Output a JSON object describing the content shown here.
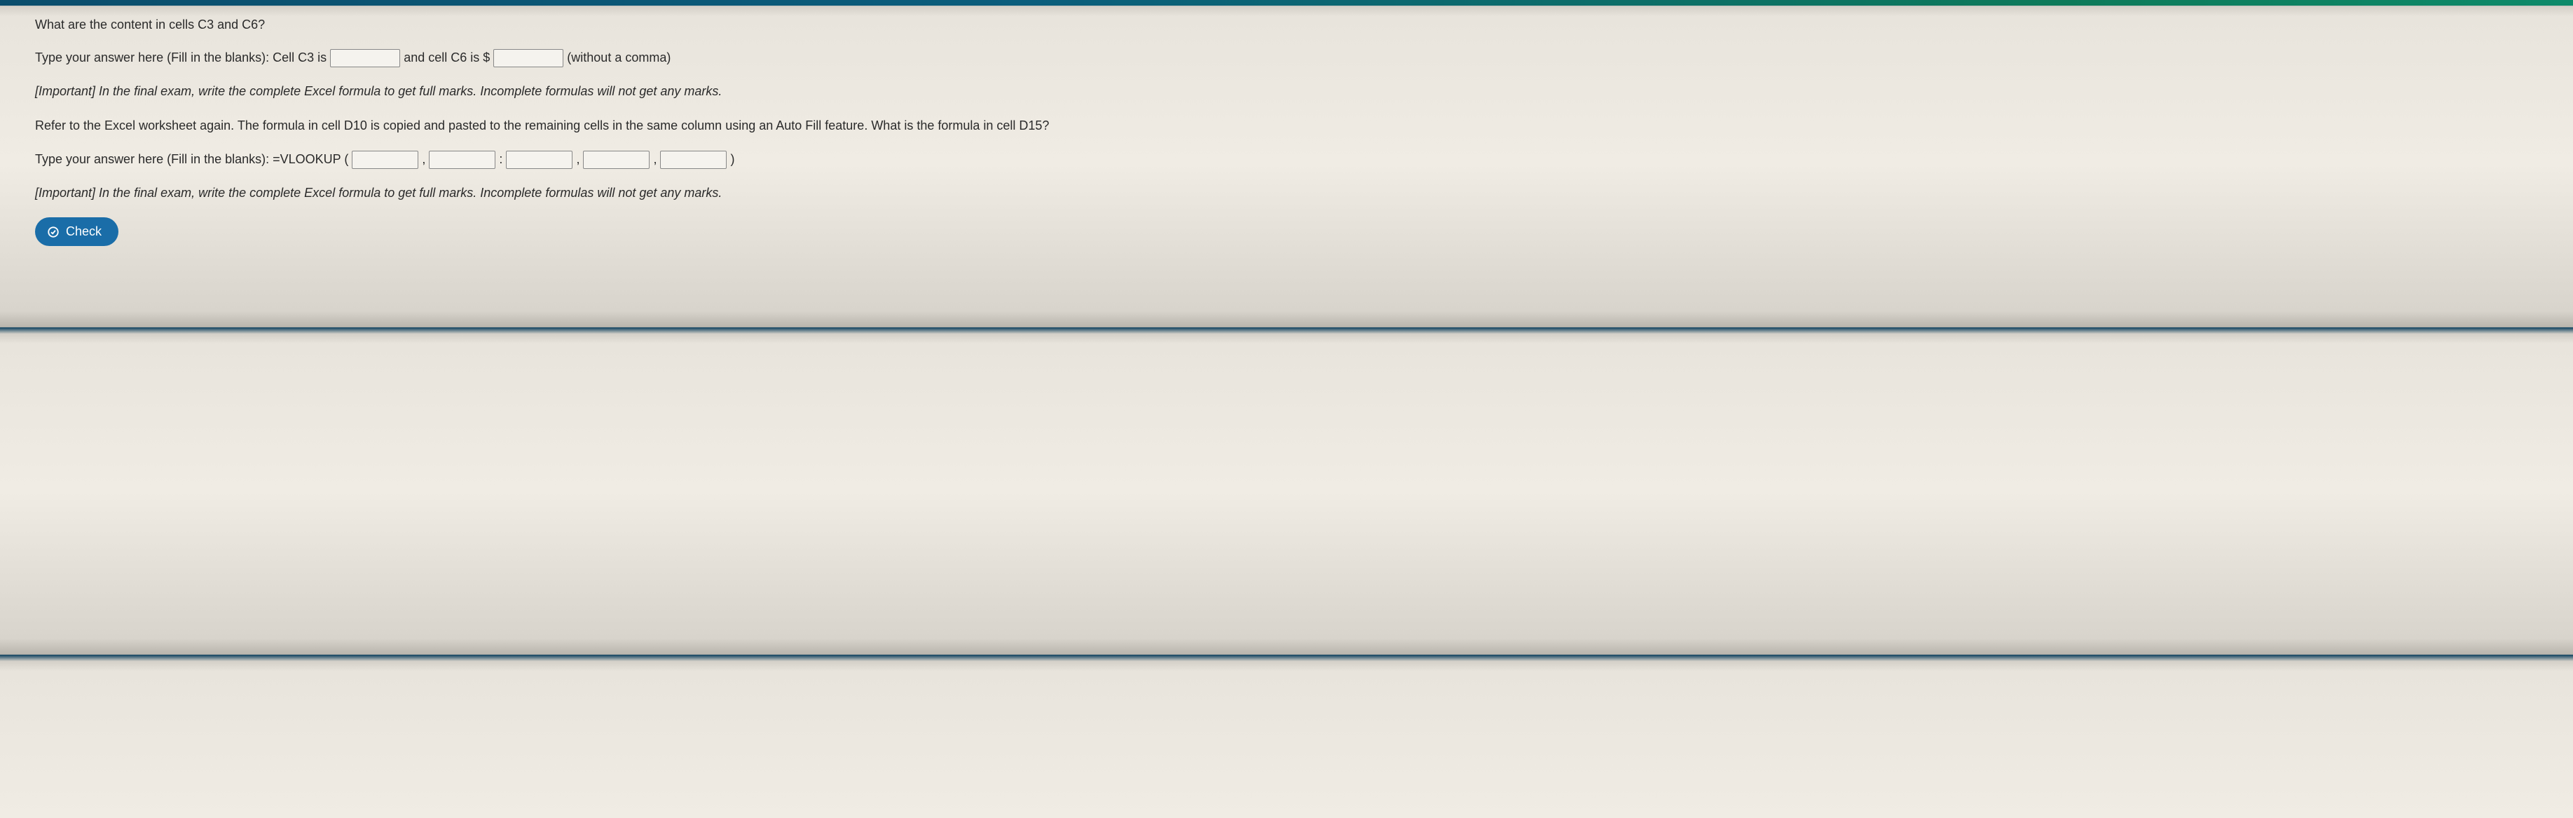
{
  "q1": {
    "prompt": "What are the content in cells C3 and C6?",
    "answer_lead": "Type your answer here (Fill in the blanks): Cell C3 is ",
    "mid1": " and cell C6 is $",
    "tail": " (without a comma)"
  },
  "note1": "[Important] In the final exam, write the complete Excel formula to get full marks. Incomplete formulas will not get any marks.",
  "q2": {
    "para": "Refer to the Excel worksheet again. The formula in cell D10 is copied and pasted to the remaining cells in the same column using an Auto Fill feature.  What is the formula in cell D15?",
    "answer_lead": "Type your answer here (Fill in the blanks): =VLOOKUP ( ",
    "sep_comma": " , ",
    "sep_colon": " : ",
    "tail": " )"
  },
  "note2": "[Important] In the final exam, write the complete Excel formula to get full marks. Incomplete formulas will not get any marks.",
  "check_label": "Check",
  "inputs": {
    "c3": "",
    "c6": "",
    "v1": "",
    "v2": "",
    "v3": "",
    "v4": "",
    "v5": ""
  }
}
